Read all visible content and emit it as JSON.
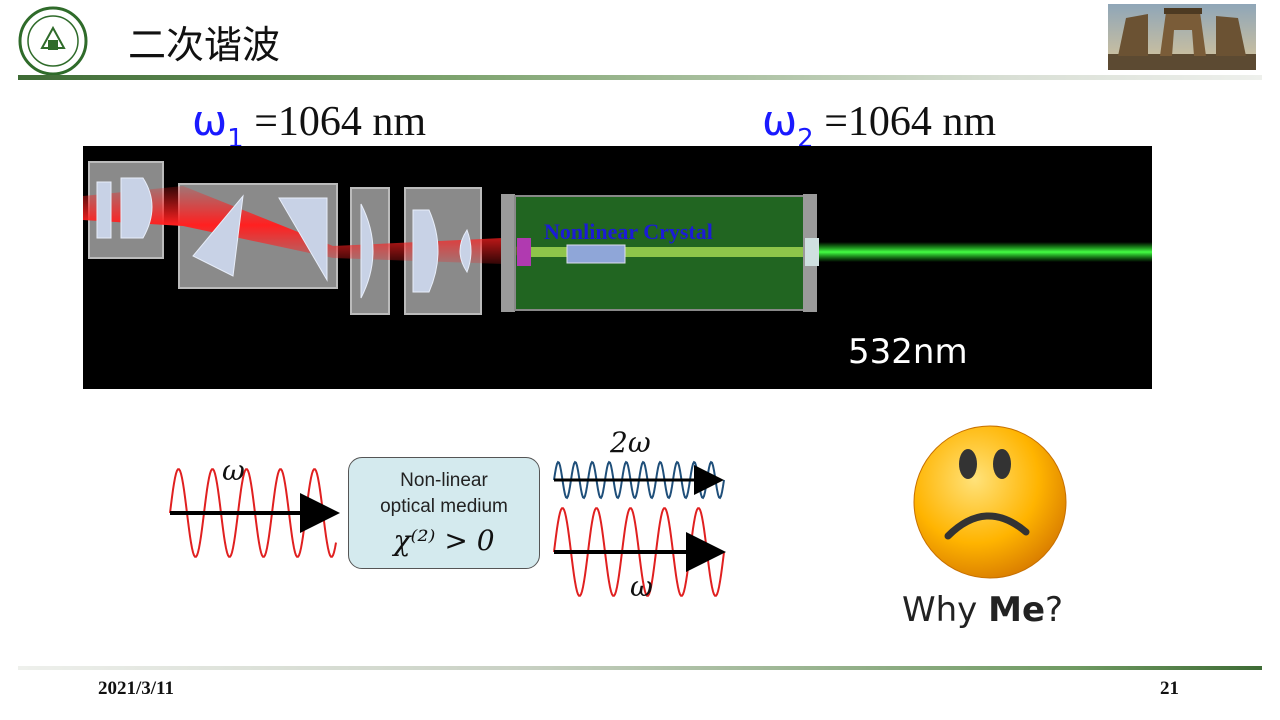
{
  "header": {
    "title": "二次谐波",
    "logo_icon": "university-seal-icon",
    "photo_icon": "campus-gate-photo"
  },
  "wavelengths": {
    "omega1": {
      "symbol": "ω",
      "sub": "1",
      "value": "=1064 nm"
    },
    "omega2": {
      "symbol": "ω",
      "sub": "2",
      "value": "=1064 nm"
    }
  },
  "laser_figure": {
    "crystal_label": "Nonlinear Crystal",
    "output_wavelength": "532nm",
    "colors": {
      "infrared_beam": "#ff2020",
      "green_beam": "#22ee22",
      "crystal_tint": "#3db83d"
    }
  },
  "diagram": {
    "input_label": "ω",
    "medium_line1": "Non-linear",
    "medium_line2": "optical medium",
    "chi_expression": "χ⁽²⁾ > 0",
    "output_top_label": "2ω",
    "output_bottom_label": "ω",
    "colors": {
      "red_wave": "#e02020",
      "blue_wave": "#1f4f7a",
      "box_fill": "#d4eaee"
    }
  },
  "reaction": {
    "face_icon": "sad-face-icon",
    "why_prefix": "Why ",
    "why_bold": "Me",
    "why_suffix": "?"
  },
  "footer": {
    "date": "2021/3/11",
    "page": "21"
  }
}
